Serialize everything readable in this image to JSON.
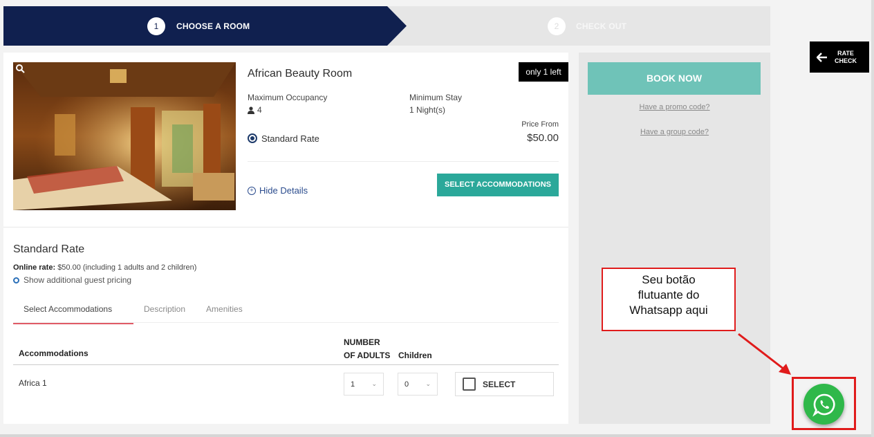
{
  "stepper": {
    "step1_num": "1",
    "step1_label": "CHOOSE A ROOM",
    "step2_num": "2",
    "step2_label": "CHECK OUT"
  },
  "room": {
    "title": "African Beauty Room",
    "availability_badge": "only 1 left",
    "occupancy_label": "Maximum Occupancy",
    "occupancy_value": "4",
    "min_stay_label": "Minimum Stay",
    "min_stay_value": "1 Night(s)",
    "rate_option": "Standard Rate",
    "price_from_label": "Price From",
    "price_from_value": "$50.00",
    "hide_details": "Hide Details",
    "select_accommodations_btn": "SELECT ACCOMMODATIONS"
  },
  "rate_details": {
    "title": "Standard Rate",
    "online_rate_label": "Online rate:",
    "online_rate_text": "$50.00 (including 1 adults and 2 children)",
    "show_additional": "Show additional guest pricing"
  },
  "tabs": [
    {
      "label": "Select Accommodations",
      "active": true
    },
    {
      "label": "Description",
      "active": false
    },
    {
      "label": "Amenities",
      "active": false
    }
  ],
  "table": {
    "col_accommodations": "Accommodations",
    "col_adults_line1": "NUMBER",
    "col_adults_line2": "OF ADULTS",
    "col_children": "Children",
    "rows": [
      {
        "name": "Africa 1",
        "adults": "1",
        "children": "0",
        "select_label": "SELECT"
      }
    ]
  },
  "side_panel": {
    "book_now": "BOOK NOW",
    "promo_code": "Have a promo code?",
    "group_code": "Have a group code?"
  },
  "rate_check": {
    "line1": "RATE",
    "line2": "CHECK"
  },
  "annotation": {
    "line1": "Seu botão",
    "line2": "flutuante do",
    "line3": "Whatsapp aqui"
  },
  "colors": {
    "navy": "#10204f",
    "teal": "#2ba89a",
    "book_now": "#6fc3b8",
    "whatsapp_green": "#2fb84a",
    "annotation_red": "#e01b1b",
    "tab_underline": "#e05a66"
  },
  "icons": [
    "search-icon",
    "person-icon",
    "plus-circle-icon",
    "arrow-left-icon",
    "chevron-down-icon",
    "whatsapp-icon",
    "red-arrow"
  ]
}
